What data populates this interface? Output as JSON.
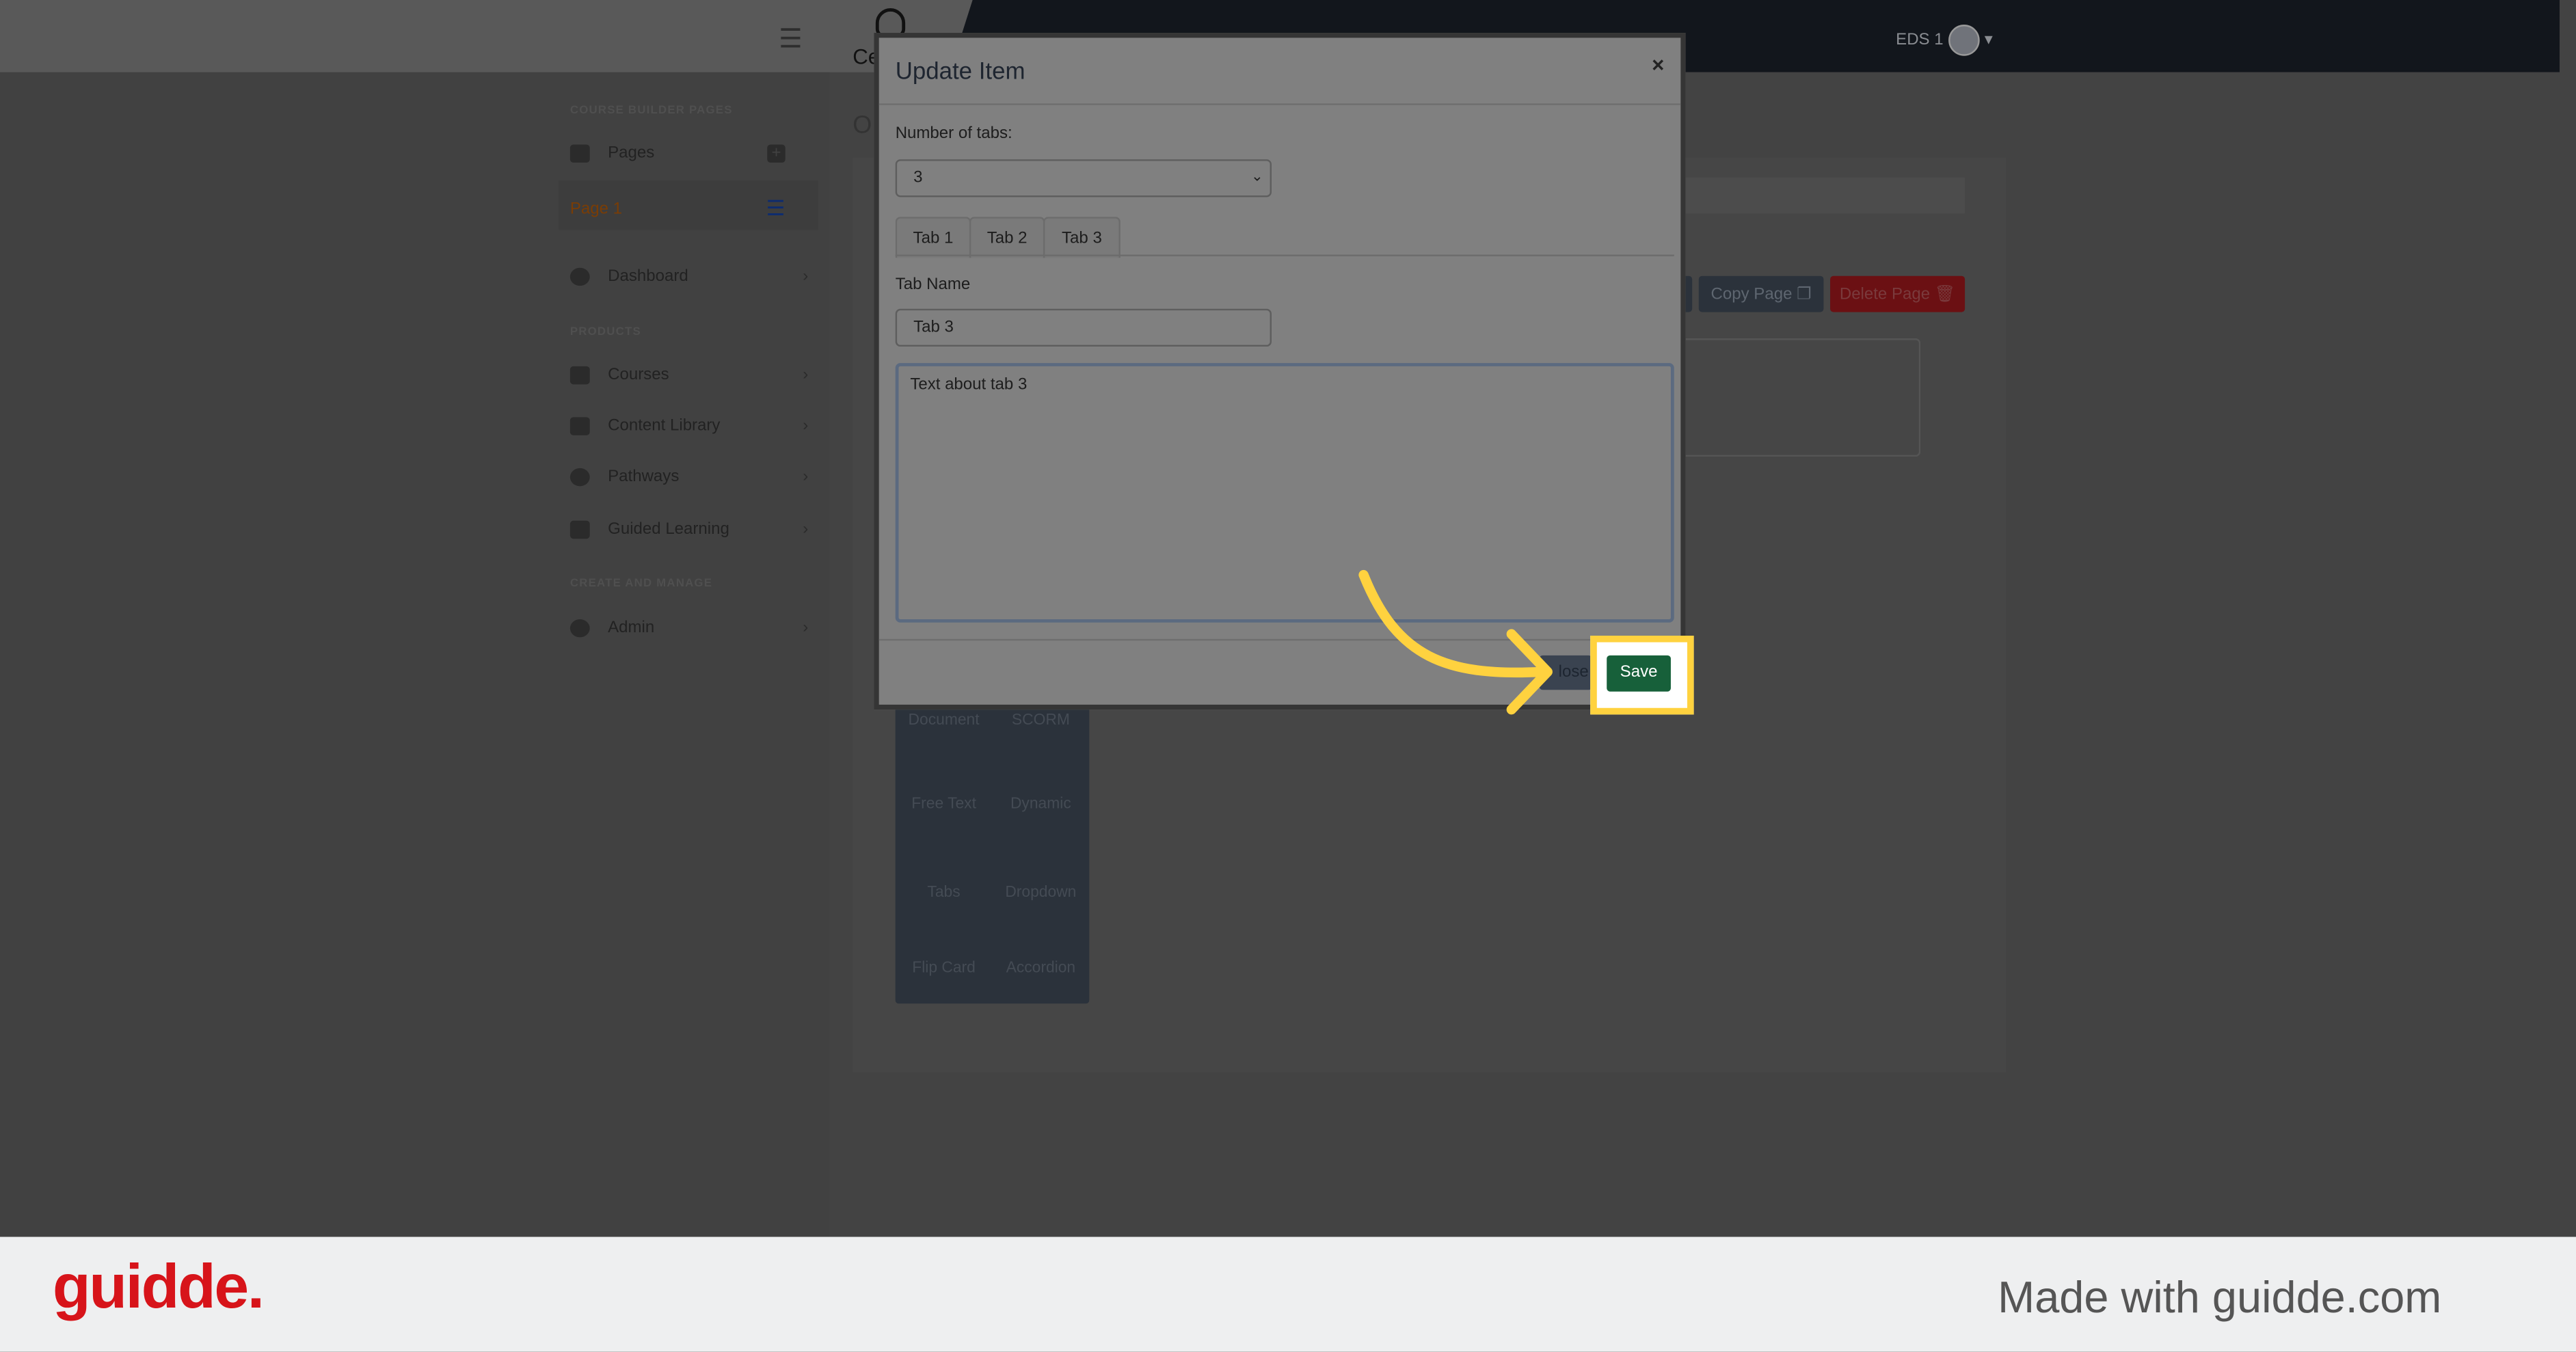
{
  "topbar": {
    "user_label": "EDS 1",
    "brand_partial": "Ce"
  },
  "sidebar": {
    "section_pages": "COURSE BUILDER PAGES",
    "pages_label": "Pages",
    "page1_label": "Page 1",
    "dashboard": "Dashboard",
    "section_products": "PRODUCTS",
    "items": [
      {
        "label": "Courses"
      },
      {
        "label": "Content Library"
      },
      {
        "label": "Pathways"
      },
      {
        "label": "Guided Learning"
      }
    ],
    "section_manage": "CREATE AND MANAGE",
    "admin": "Admin"
  },
  "content": {
    "title_partial": "O",
    "copy_page": "Copy Page",
    "delete_page": "Delete Page",
    "palette": [
      "Document",
      "SCORM",
      "Free Text",
      "Dynamic",
      "Tabs",
      "Dropdown",
      "Flip Card",
      "Accordion"
    ]
  },
  "modal": {
    "title": "Update Item",
    "close_symbol": "×",
    "num_tabs_label": "Number of tabs:",
    "num_tabs_value": "3",
    "tabs": [
      "Tab 1",
      "Tab 2",
      "Tab 3"
    ],
    "tab_name_label": "Tab Name",
    "tab_name_value": "Tab 3",
    "text_value": "Text about tab 3",
    "close_button_partial": "lose",
    "save_button": "Save"
  },
  "colors": {
    "save": "#17603a",
    "delete": "#c4161c",
    "highlight": "#ffd23f",
    "accent_arrow": "#ffd23f"
  },
  "footer": {
    "logo": "guidde.",
    "made_with": "Made with guidde.com"
  }
}
